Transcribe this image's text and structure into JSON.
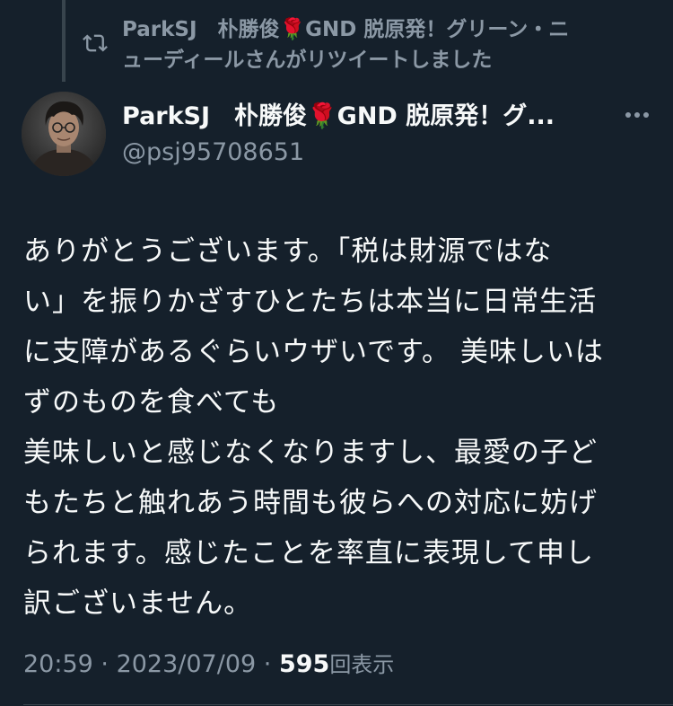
{
  "retweet": {
    "name_before": "ParkSJ　朴勝俊",
    "rose": "🌹",
    "name_after": "GND 脱原発！グリーン・ニ",
    "line2": "ューディールさんがリツイートしました"
  },
  "author": {
    "name_before": "ParkSJ　朴勝俊",
    "rose": "🌹",
    "name_after": "GND 脱原発！グ...",
    "handle": "@psj95708651"
  },
  "tweet": {
    "lines": [
      "ありがとうございます。「税は財源ではな",
      "い」を振りかざすひとたちは本当に日常生活",
      "に支障があるぐらいウザいです。 美味しいは",
      "ずのものを食べても",
      "美味しいと感じなくなりますし、最愛の子ど",
      "もたちと触れあう時間も彼らへの対応に妨げ",
      "られます。感じたことを率直に表現して申し",
      "訳ございません。"
    ]
  },
  "meta": {
    "time": "20:59",
    "sep1": " · ",
    "date": "2023/07/09",
    "sep2": " · ",
    "views_count": "595",
    "views_label": "回表示"
  },
  "icons": {
    "retweet": "retweet-icon",
    "more": "more-icon",
    "avatar": "avatar"
  },
  "colors": {
    "background": "#15202b",
    "primary_text": "#f7f9f9",
    "secondary_text": "#8b98a5",
    "rose": "#d81f2a"
  }
}
